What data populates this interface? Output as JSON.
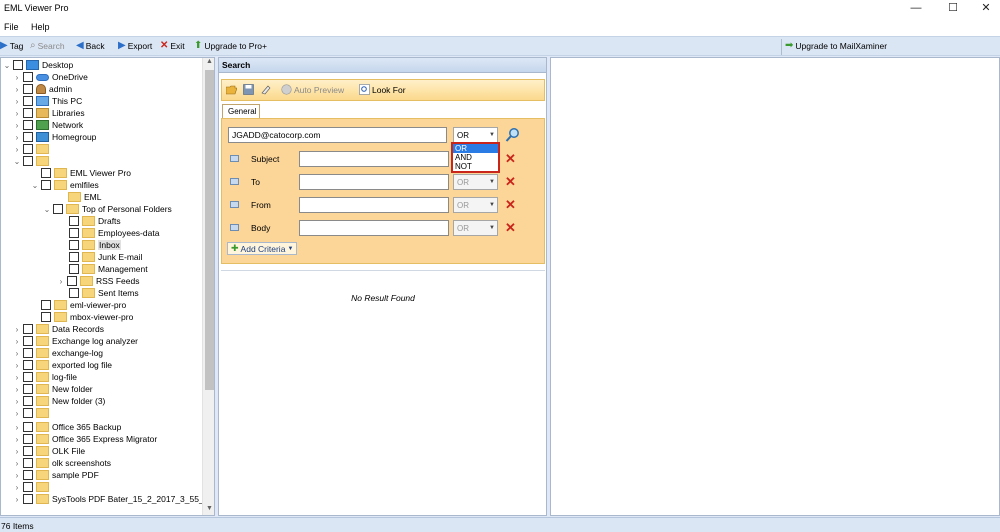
{
  "window": {
    "title": "EML Viewer Pro",
    "minimize": "—",
    "maximize": "☐",
    "close": "✕"
  },
  "menu": [
    "File",
    "Help"
  ],
  "toolbar": {
    "tag": "Tag",
    "search": "Search",
    "back": "Back",
    "export": "Export",
    "exit": "Exit",
    "upgrade_pro": "Upgrade to Pro+",
    "upgrade_mx": "Upgrade to MailXaminer"
  },
  "tree": {
    "items": [
      "Desktop",
      "OneDrive",
      "admin",
      "This PC",
      "Libraries",
      "Network",
      "Homegroup",
      "",
      "",
      "EML Viewer Pro",
      "emlfiles",
      "EML",
      "Top of Personal Folders",
      "Drafts",
      "Employees-data",
      "Inbox",
      "Junk E-mail",
      "Management",
      "RSS Feeds",
      "Sent Items",
      "eml-viewer-pro",
      "mbox-viewer-pro",
      "Data Records",
      "Exchange log analyzer",
      "exchange-log",
      "exported log file",
      "log-file",
      "New folder",
      "New folder (3)",
      "",
      "Office 365 Backup",
      "Office 365 Express Migrator",
      "OLK File",
      "olk screenshots",
      "sample PDF",
      "",
      "SysTools PDF Bater_15_2_2017_3_55_1"
    ]
  },
  "search": {
    "header": "Search",
    "auto_preview": "Auto Preview",
    "look_for": "Look For",
    "tab": "General",
    "email_value": "JGADD@catocorp.com",
    "email_op": "OR",
    "fields": [
      {
        "label": "Subject",
        "op": "OR"
      },
      {
        "label": "To",
        "op": "OR"
      },
      {
        "label": "From",
        "op": "OR"
      },
      {
        "label": "Body",
        "op": "OR"
      }
    ],
    "dropdown": [
      "OR",
      "AND",
      "NOT"
    ],
    "add_criteria": "Add Criteria",
    "no_result": "No Result Found"
  },
  "status": {
    "items": "76 Items"
  },
  "colors": {
    "accent": "#2b7be4",
    "criteria_bg": "#fcd699",
    "delete": "#c9251a"
  }
}
